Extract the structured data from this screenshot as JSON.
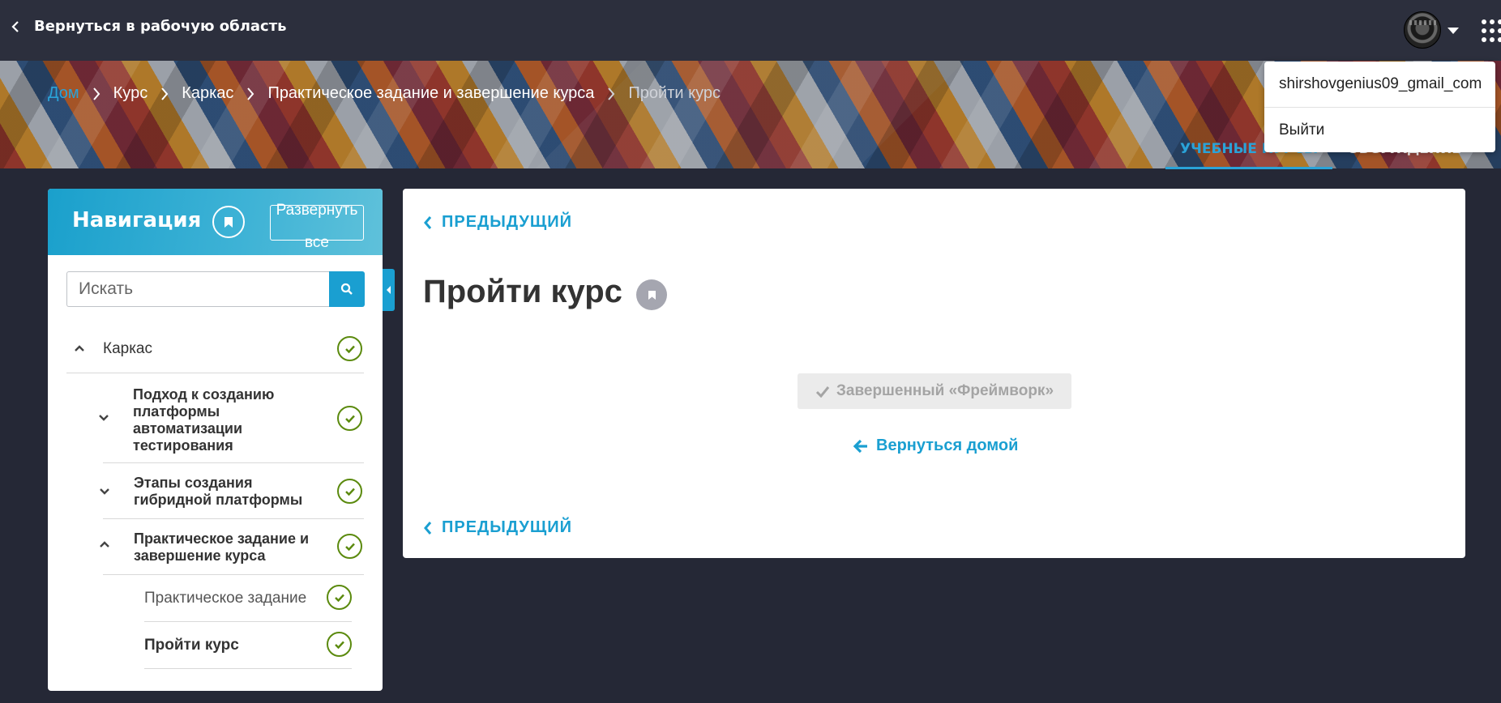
{
  "topbar": {
    "back_label": "Вернуться в рабочую область"
  },
  "user_menu": {
    "username": "shirshovgenius09_gmail_com",
    "logout_label": "Выйти"
  },
  "breadcrumb": [
    "Дом",
    "Курс",
    "Каркас",
    "Практическое задание и завершение курса",
    "Пройти курс"
  ],
  "banner_tabs": [
    {
      "label": "УЧЕБНЫЕ КУРСЫ",
      "active": true
    },
    {
      "label": "ОБСУЖДЕНИЕ",
      "active": false
    }
  ],
  "sidebar": {
    "title": "Навигация",
    "expand_label": "Развернуть все",
    "search_placeholder": "Искать",
    "items": [
      {
        "label": "Каркас"
      },
      {
        "label": "Подход к созданию платформы автоматизации тестирования"
      },
      {
        "label": "Этапы создания гибридной платформы"
      },
      {
        "label": "Практическое задание и завершение курса"
      },
      {
        "label": "Практическое задание"
      },
      {
        "label": "Пройти курс"
      }
    ]
  },
  "main": {
    "prev_label": "ПРЕДЫДУЩИЙ",
    "page_title": "Пройти курс",
    "complete_label": "Завершенный «Фреймворк»",
    "home_label": "Вернуться домой"
  },
  "colors": {
    "accent": "#1a9fd1",
    "check": "#5b8a0e",
    "topbar": "#2c2f3d",
    "page_bg": "#252836"
  }
}
